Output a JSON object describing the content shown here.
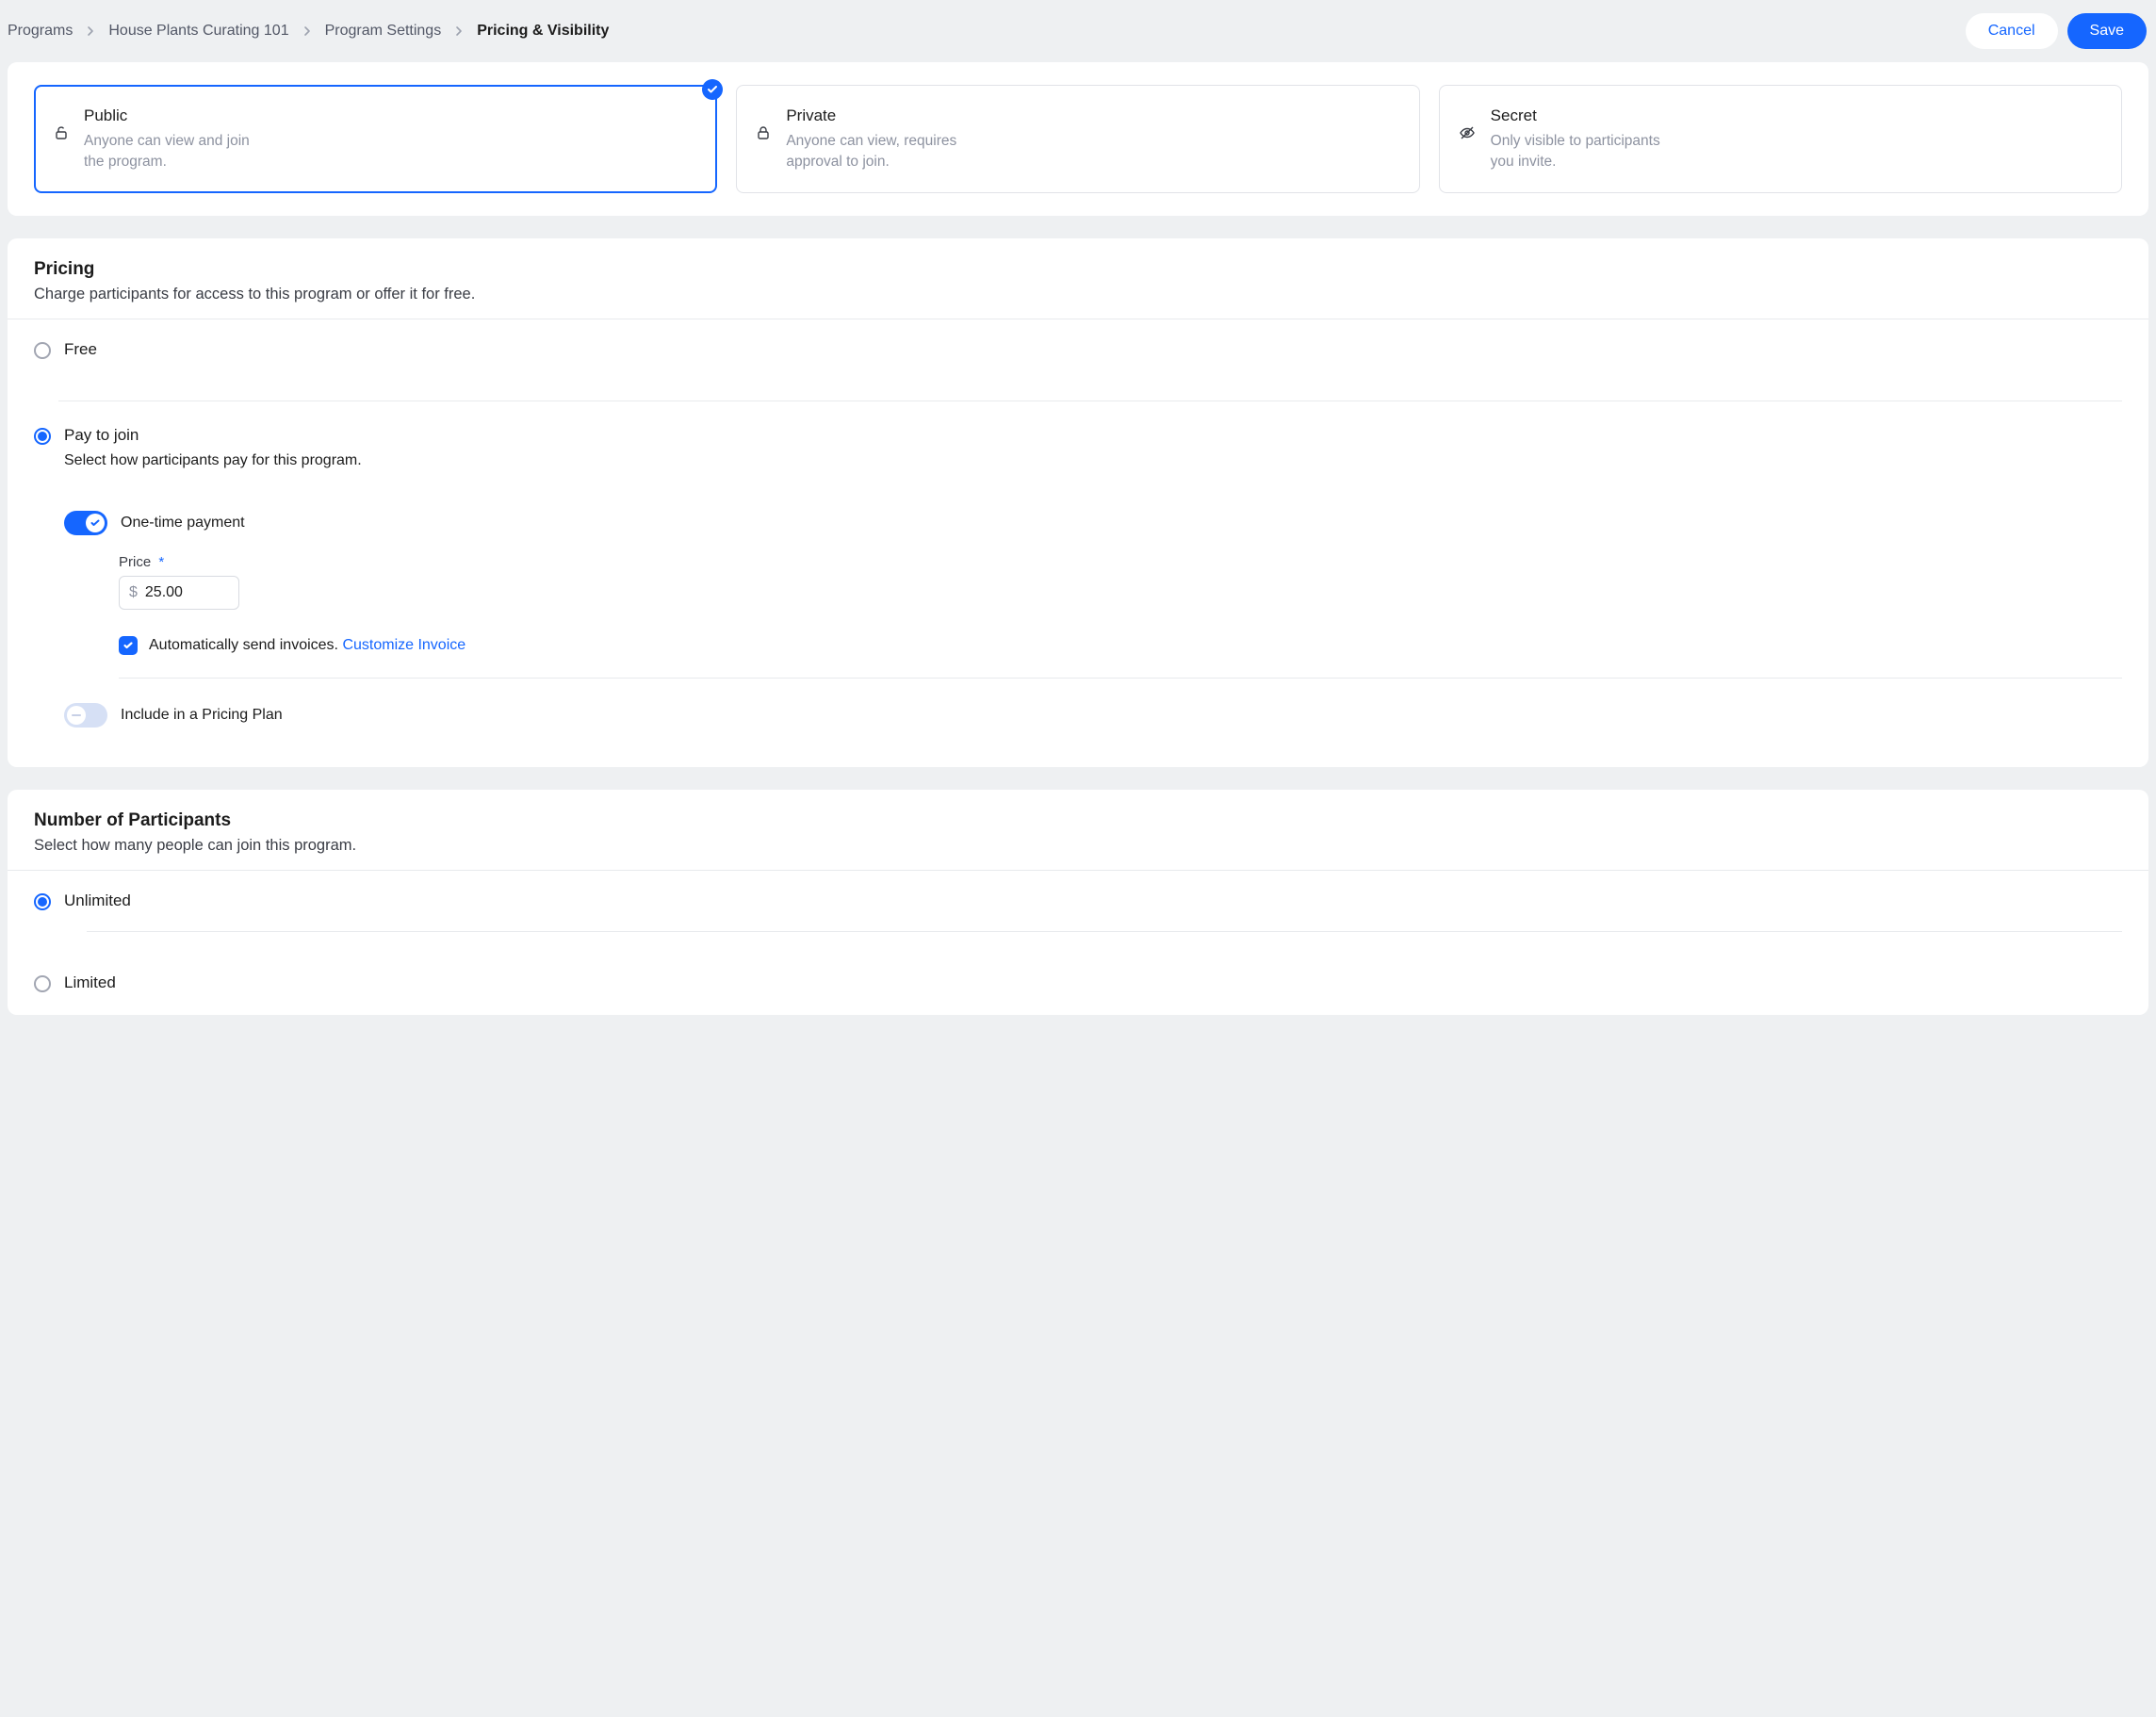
{
  "breadcrumb": {
    "items": [
      "Programs",
      "House Plants Curating 101",
      "Program Settings",
      "Pricing & Visibility"
    ]
  },
  "buttons": {
    "cancel": "Cancel",
    "save": "Save"
  },
  "visibility": {
    "options": [
      {
        "title": "Public",
        "desc": "Anyone can view and join the program."
      },
      {
        "title": "Private",
        "desc": "Anyone can view, requires approval to join."
      },
      {
        "title": "Secret",
        "desc": "Only visible to participants you invite."
      }
    ]
  },
  "pricing": {
    "title": "Pricing",
    "subtitle": "Charge participants for access to this program or offer it for free.",
    "free_label": "Free",
    "pay": {
      "label": "Pay to join",
      "sub": "Select how participants pay for this program.",
      "onetime_label": "One-time payment",
      "price_label": "Price",
      "currency": "$",
      "price_value": "25.00",
      "invoice_label": "Automatically send invoices.",
      "invoice_link": "Customize Invoice",
      "plan_label": "Include in a Pricing Plan"
    }
  },
  "participants": {
    "title": "Number of Participants",
    "subtitle": "Select how many people can join this program.",
    "unlimited": "Unlimited",
    "limited": "Limited"
  }
}
